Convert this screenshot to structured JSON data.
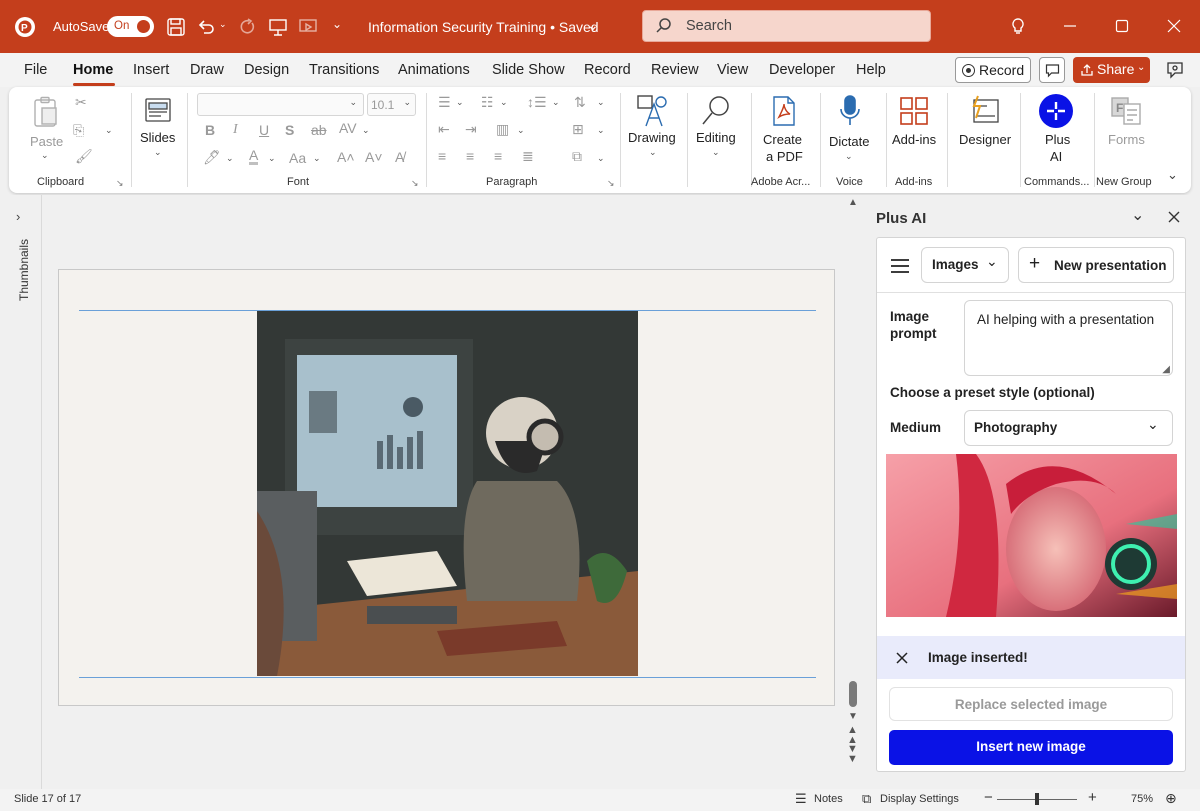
{
  "titlebar": {
    "autosave_label": "AutoSave",
    "autosave_state": "On",
    "doc_title": "Information Security Training • Saved",
    "search_placeholder": "Search"
  },
  "tabs": [
    "File",
    "Home",
    "Insert",
    "Draw",
    "Design",
    "Transitions",
    "Animations",
    "Slide Show",
    "Record",
    "Review",
    "View",
    "Developer",
    "Help"
  ],
  "active_tab": "Home",
  "actions": {
    "record": "Record",
    "share": "Share"
  },
  "ribbon": {
    "paste": "Paste",
    "slides": "Slides",
    "font_size": "10.1",
    "drawing": "Drawing",
    "editing": "Editing",
    "create_pdf_1": "Create",
    "create_pdf_2": "a PDF",
    "dictate": "Dictate",
    "addins": "Add-ins",
    "designer": "Designer",
    "plus_ai_1": "Plus",
    "plus_ai_2": "AI",
    "forms": "Forms",
    "groups": {
      "clipboard": "Clipboard",
      "font": "Font",
      "paragraph": "Paragraph",
      "adobe": "Adobe Acr...",
      "voice": "Voice",
      "addins": "Add-ins",
      "commands": "Commands...",
      "new_group": "New Group"
    }
  },
  "thumbnails_label": "Thumbnails",
  "slide_image_desc": "ai-robot-at-desk-photo",
  "pane": {
    "title": "Plus AI",
    "mode": "Images",
    "new_presentation": "New presentation",
    "prompt_label_1": "Image",
    "prompt_label_2": "prompt",
    "prompt_value": "AI helping with a presentation",
    "preset_label": "Choose a preset style (optional)",
    "medium_label": "Medium",
    "medium_value": "Photography",
    "toast": "Image inserted!",
    "replace_button": "Replace selected image",
    "insert_button": "Insert new image"
  },
  "status": {
    "slide_info": "Slide 17 of 17",
    "notes": "Notes",
    "display_settings": "Display Settings",
    "zoom": "75%",
    "zoom_level": 0.5
  },
  "colors": {
    "accent": "#c43e1c",
    "insert_button": "#0a12e6",
    "toast_bg": "#e9ebfb"
  }
}
